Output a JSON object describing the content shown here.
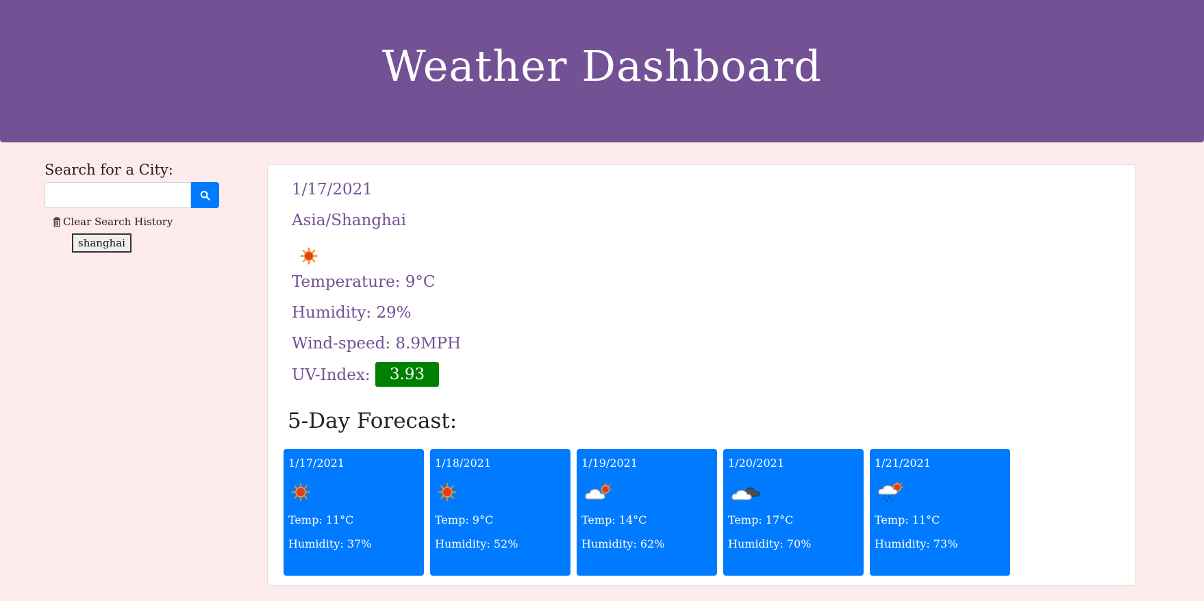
{
  "header": {
    "title": "Weather Dashboard"
  },
  "sidebar": {
    "search_label": "Search for a City:",
    "search_value": "",
    "search_icon": "search-icon",
    "clear_label": "Clear Search History",
    "clear_icon": "trash-icon",
    "history": [
      "shanghai"
    ]
  },
  "current": {
    "date": "1/17/2021",
    "timezone": "Asia/Shanghai",
    "icon": "sun-icon",
    "temperature": "Temperature: 9°C",
    "humidity": "Humidity: 29%",
    "wind": "Wind-speed: 8.9MPH",
    "uv_label": "UV-Index:",
    "uv_value": "3.93",
    "uv_color": "#008000"
  },
  "forecast": {
    "title": "5-Day Forecast:",
    "days": [
      {
        "date": "1/17/2021",
        "icon": "sun-icon",
        "temp": "Temp: 11°C",
        "humidity": "Humidity: 37%"
      },
      {
        "date": "1/18/2021",
        "icon": "sun-icon",
        "temp": "Temp: 9°C",
        "humidity": "Humidity: 52%"
      },
      {
        "date": "1/19/2021",
        "icon": "partly-cloudy-icon",
        "temp": "Temp: 14°C",
        "humidity": "Humidity: 62%"
      },
      {
        "date": "1/20/2021",
        "icon": "cloudy-icon",
        "temp": "Temp: 17°C",
        "humidity": "Humidity: 70%"
      },
      {
        "date": "1/21/2021",
        "icon": "rain-sun-icon",
        "temp": "Temp: 11°C",
        "humidity": "Humidity: 73%"
      }
    ]
  },
  "colors": {
    "header_bg": "#725295",
    "page_bg": "#fdeceb",
    "accent_text": "#725295",
    "forecast_card": "#007bff",
    "search_button": "#007bff"
  }
}
